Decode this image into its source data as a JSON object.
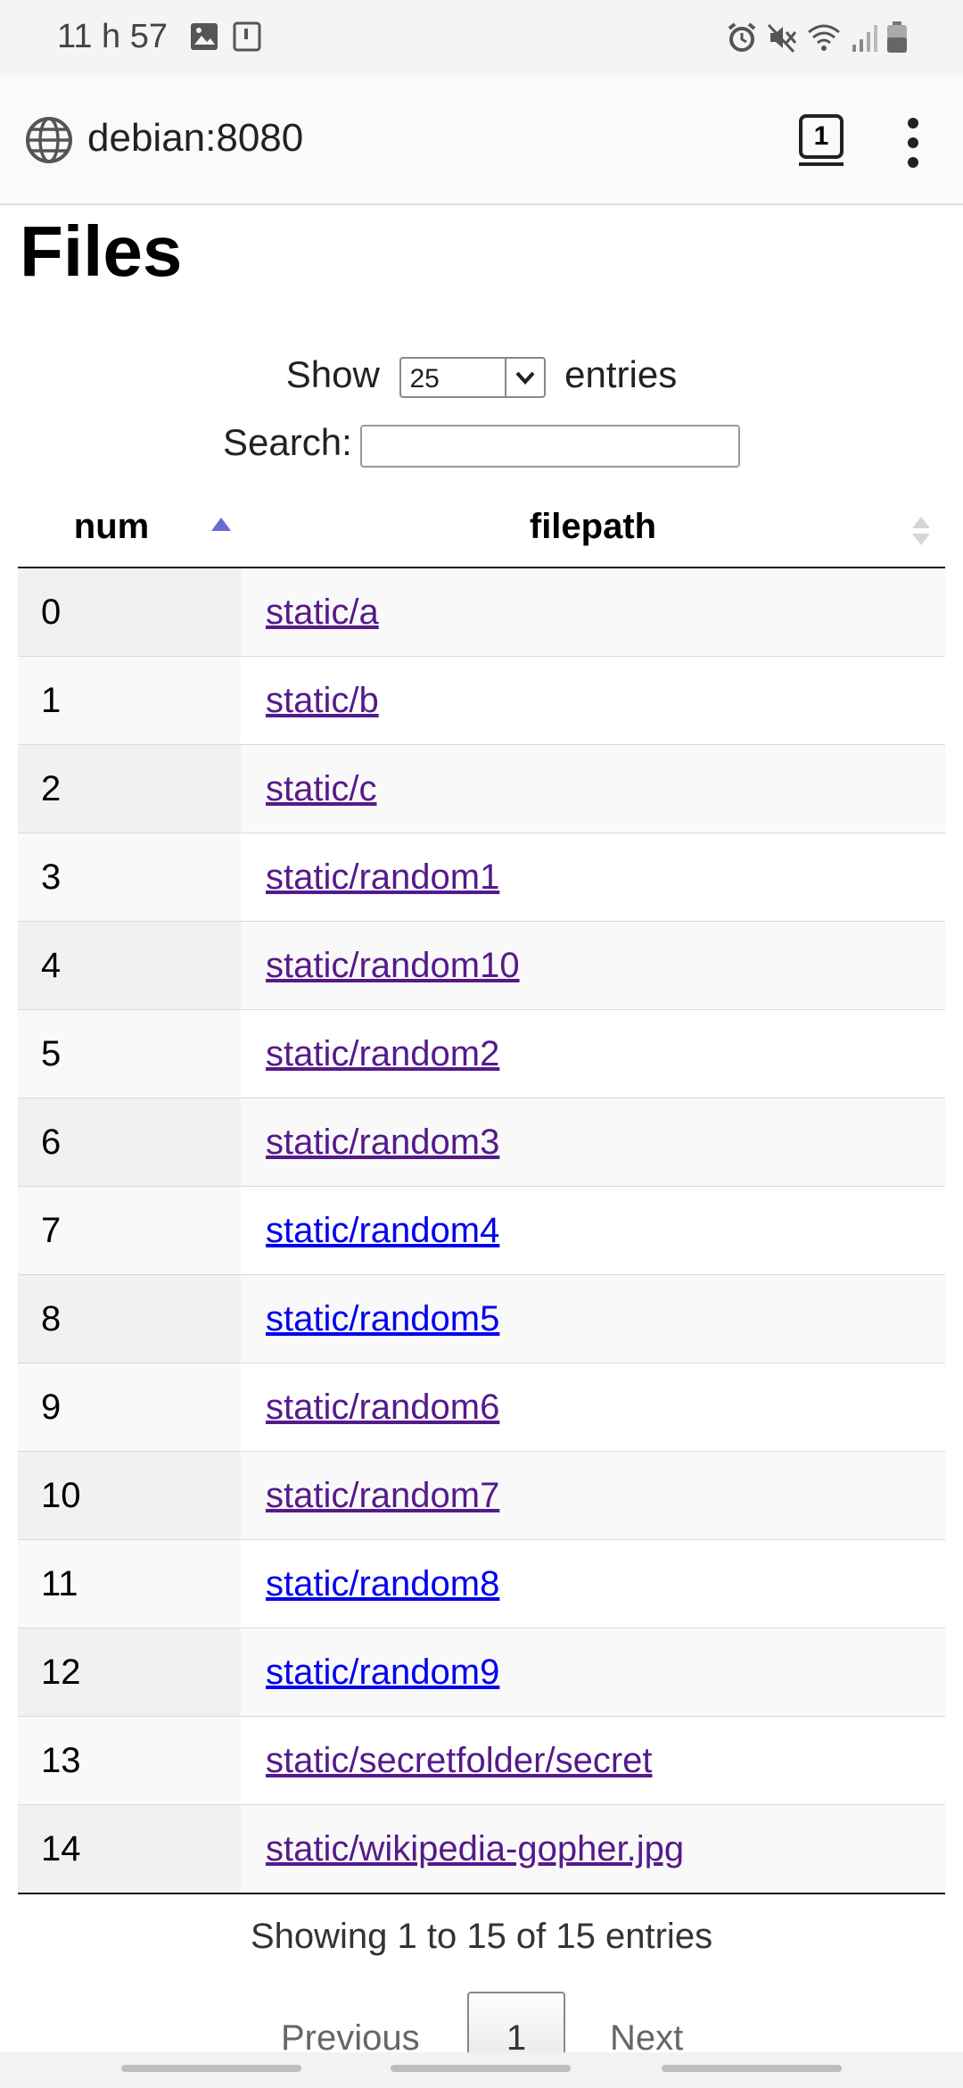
{
  "status_bar": {
    "time": "11 h 57",
    "left_icons": [
      "image-icon",
      "sim-icon"
    ],
    "right_icons": [
      "alarm-icon",
      "mute-icon",
      "wifi-icon",
      "signal-icon",
      "battery-icon"
    ]
  },
  "browser": {
    "url": "debian:8080",
    "tab_count": "1"
  },
  "page": {
    "title": "Files",
    "length": {
      "prefix": "Show",
      "selected": "25",
      "suffix": "entries"
    },
    "search": {
      "label": "Search:",
      "value": ""
    },
    "table": {
      "columns": [
        "num",
        "filepath"
      ],
      "rows": [
        {
          "num": "0",
          "filepath": "static/a",
          "visited": true
        },
        {
          "num": "1",
          "filepath": "static/b",
          "visited": true
        },
        {
          "num": "2",
          "filepath": "static/c",
          "visited": true
        },
        {
          "num": "3",
          "filepath": "static/random1",
          "visited": true
        },
        {
          "num": "4",
          "filepath": "static/random10",
          "visited": true
        },
        {
          "num": "5",
          "filepath": "static/random2",
          "visited": true
        },
        {
          "num": "6",
          "filepath": "static/random3",
          "visited": true
        },
        {
          "num": "7",
          "filepath": "static/random4",
          "visited": false
        },
        {
          "num": "8",
          "filepath": "static/random5",
          "visited": false
        },
        {
          "num": "9",
          "filepath": "static/random6",
          "visited": true
        },
        {
          "num": "10",
          "filepath": "static/random7",
          "visited": true
        },
        {
          "num": "11",
          "filepath": "static/random8",
          "visited": false
        },
        {
          "num": "12",
          "filepath": "static/random9",
          "visited": false
        },
        {
          "num": "13",
          "filepath": "static/secretfolder/secret",
          "visited": true
        },
        {
          "num": "14",
          "filepath": "static/wikipedia-gopher.jpg",
          "visited": true
        }
      ]
    },
    "info": "Showing 1 to 15 of 15 entries",
    "pagination": {
      "previous": "Previous",
      "current": "1",
      "next": "Next"
    }
  },
  "colors": {
    "link": "#0000ee",
    "visited_link": "#551a8b",
    "sort_active": "#6b6bd6"
  }
}
